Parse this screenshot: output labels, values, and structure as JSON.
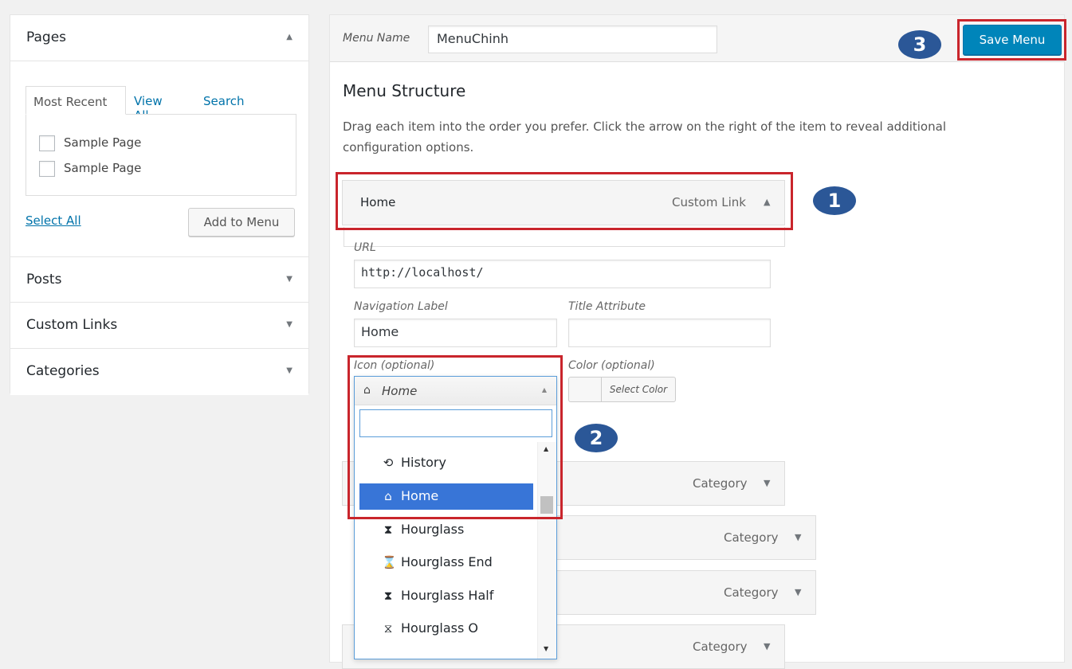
{
  "sidebar": {
    "pages": {
      "title": "Pages",
      "tabs": [
        "Most Recent",
        "View All",
        "Search"
      ],
      "items": [
        "Sample Page",
        "Sample Page"
      ],
      "select_all": "Select All",
      "add_button": "Add to Menu"
    },
    "sections": [
      {
        "title": "Posts"
      },
      {
        "title": "Custom Links"
      },
      {
        "title": "Categories"
      }
    ]
  },
  "header": {
    "menu_name_label": "Menu Name",
    "menu_name_value": "MenuChinh",
    "save_button": "Save Menu"
  },
  "structure": {
    "title": "Menu Structure",
    "description_line1": "Drag each item into the order you prefer. Click the arrow on the right of the item to reveal additional",
    "description_line2": "configuration options."
  },
  "menu_item": {
    "title": "Home",
    "type": "Custom Link",
    "url_label": "URL",
    "url_value": "http://localhost/",
    "nav_label": "Navigation Label",
    "nav_value": "Home",
    "title_attr_label": "Title Attribute",
    "title_attr_value": "",
    "icon_label": "Icon (optional)",
    "color_label": "Color (optional)",
    "color_button": "Select Color"
  },
  "icon_dropdown": {
    "selected": "Home",
    "search_value": "",
    "options": [
      {
        "label": "History",
        "icon": "history-icon"
      },
      {
        "label": "Home",
        "icon": "home-icon",
        "selected": true
      },
      {
        "label": "Hourglass",
        "icon": "hourglass-icon"
      },
      {
        "label": "Hourglass End",
        "icon": "hourglass-end-icon"
      },
      {
        "label": "Hourglass Half",
        "icon": "hourglass-half-icon"
      },
      {
        "label": "Hourglass O",
        "icon": "hourglass-o-icon"
      }
    ]
  },
  "other_items": [
    {
      "type": "Category"
    },
    {
      "type": "Category"
    },
    {
      "type": "Category"
    },
    {
      "type": "Category"
    }
  ],
  "callouts": [
    "1",
    "2",
    "3"
  ],
  "colors": {
    "accent": "#0085ba",
    "callout_border": "#c9252c",
    "badge": "#2b5797",
    "selected_option": "#3875d7"
  }
}
